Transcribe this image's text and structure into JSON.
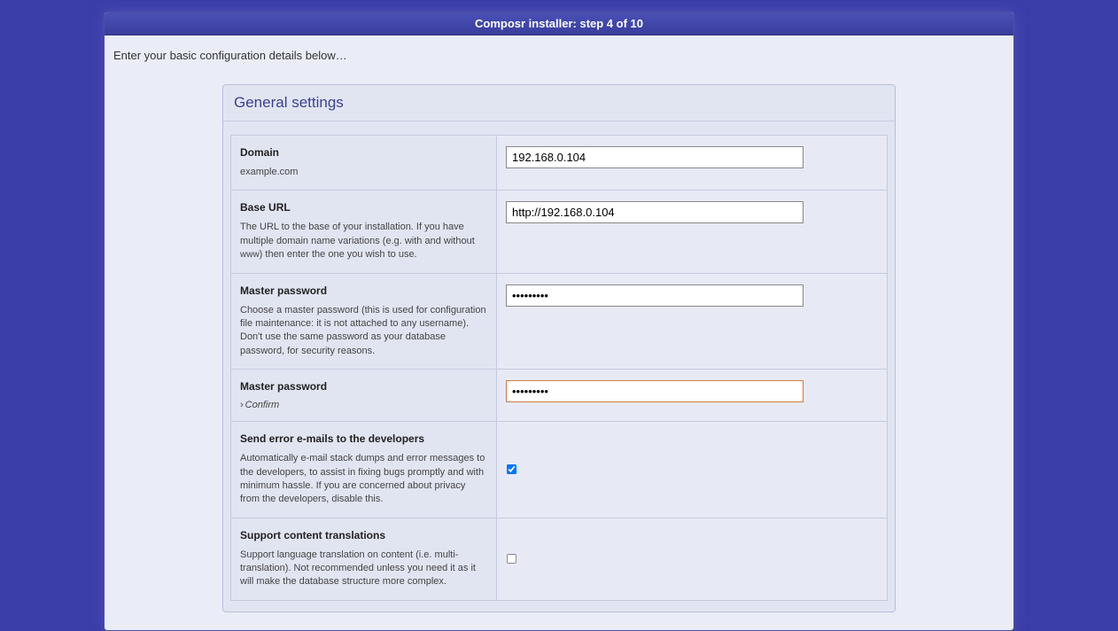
{
  "header": {
    "title": "Composr installer: step 4 of 10"
  },
  "intro": "Enter your basic configuration details below…",
  "panel": {
    "title": "General settings"
  },
  "fields": {
    "domain": {
      "label": "Domain",
      "description": "example.com",
      "value": "192.168.0.104"
    },
    "base_url": {
      "label": "Base URL",
      "description_pre": "The URL to the base of your installation. If you have multiple domain name variations (e.g. with and without ",
      "description_www": "www",
      "description_post": ") then enter the one you wish to use.",
      "value": "http://192.168.0.104"
    },
    "master_password": {
      "label": "Master password",
      "description": "Choose a master password (this is used for configuration file maintenance: it is not attached to any username). Don't use the same password as your database password, for security reasons.",
      "value": "•••••••••"
    },
    "master_password_confirm": {
      "label": "Master password",
      "confirm_arrow": "›",
      "confirm_text": "Confirm",
      "value": "•••••••••"
    },
    "send_errors": {
      "label": "Send error e-mails to the developers",
      "description": "Automatically e-mail stack dumps and error messages to the developers, to assist in fixing bugs promptly and with minimum hassle. If you are concerned about privacy from the developers, disable this.",
      "checked": true
    },
    "support_translations": {
      "label": "Support content translations",
      "description": "Support language translation on content (i.e. multi-translation). Not recommended unless you need it as it will make the database structure more complex.",
      "checked": false
    }
  }
}
